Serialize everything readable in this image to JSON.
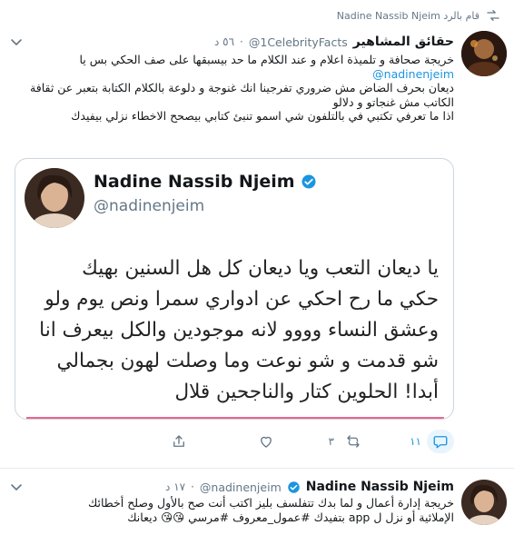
{
  "retweet_bar": {
    "label": "قام بالرد Nadine Nassib Njeim"
  },
  "tweet1": {
    "name": "حقائق المشاهير",
    "handle": "@1CelebrityFacts",
    "time": "٥٦ د",
    "body": [
      "خريجة صحافة و تلميذة اعلام و عند الكلام ما حد بيسبقها على صف الحكي بس يا",
      "@nadinenjeim",
      "ديعان بحرف الضاض مش ضروري تفرجينا انك غنوجة و دلوعة بالكلام الكتابة بتعبر عن ثقافة الكاتب مش غنجاتو و دلالو",
      "اذا ما تعرفي تكتبي في بالتلفون شي اسمو تنبئ كتابي بيصحح الاخطاء نزلي بيفيدك"
    ],
    "media": {
      "name": "Nadine Nassib Njeim",
      "handle": "@nadinenjeim",
      "lines": [
        "يا ديعان التعب ويا ديعان كل هل السنين بهيك",
        "حكي ما رح احكي عن ادواري سمرا ونص يوم ولو",
        "وعشق النساء وووو لانه موجودين والكل بيعرف انا",
        "شو قدمت و شو نوعت وما وصلت لهون بجمالي",
        "أبدا! الحلوين كتار والناجحين قلال"
      ]
    },
    "actions": {
      "reply": "١١",
      "retweet": "٣",
      "like": "",
      "share": ""
    }
  },
  "tweet2": {
    "name": "Nadine Nassib Njeim",
    "handle": "@nadinenjeim",
    "time": "١٧ د",
    "body": [
      "خريجة إدارة أعمال و لما بدك تتفلسف بليز اكتب أنت صح بالأول وصلح أخطائك",
      "الإملائية أو نزل ل app بتفيدك #عمول_معروف #مرسي 😘😘 ديعانك"
    ]
  },
  "colors": {
    "accent": "#1b95e0",
    "muted": "#657786",
    "text": "#14171a",
    "border": "#e6ecf0"
  },
  "icons": [
    "retweet-icon",
    "chevron-down-icon",
    "reply-icon",
    "retweet-icon",
    "like-icon",
    "share-icon",
    "verified-badge-icon"
  ]
}
